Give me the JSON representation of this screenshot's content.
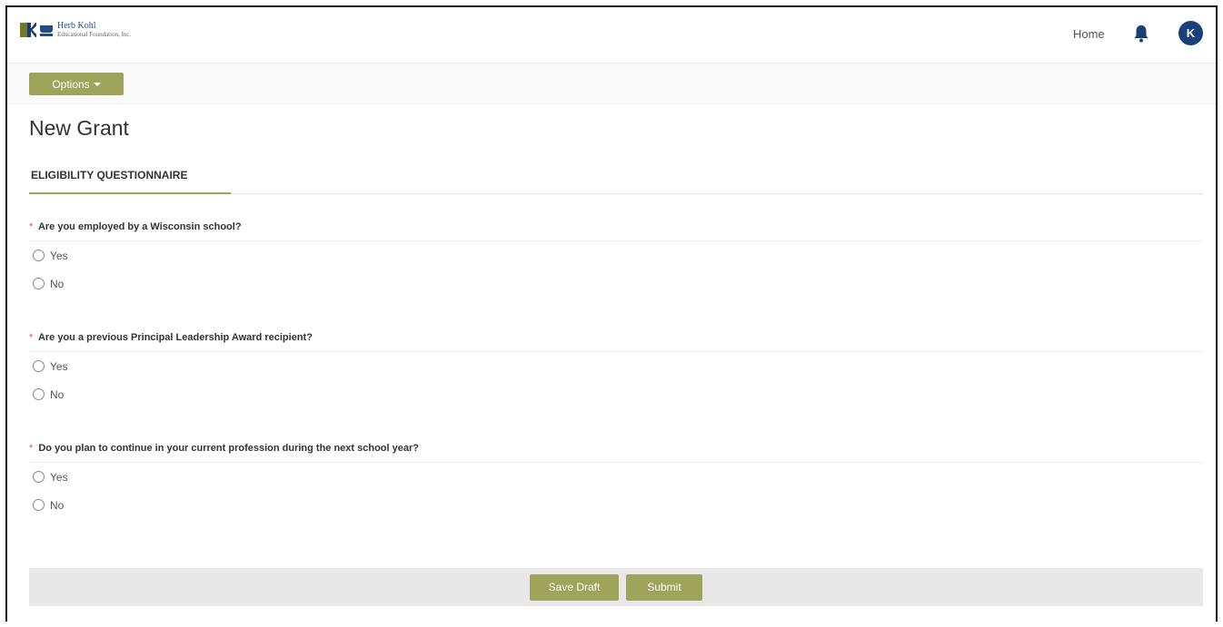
{
  "header": {
    "logo_line1": "Herb Kohl",
    "logo_line2": "Educational Foundation, Inc.",
    "home_label": "Home",
    "avatar_initial": "K",
    "brand_color": "#1a3f7a"
  },
  "options_bar": {
    "options_label": "Options",
    "accent_color": "#9ea459"
  },
  "page": {
    "title": "New Grant",
    "tab_label": "ELIGIBILITY QUESTIONNAIRE"
  },
  "questions": [
    {
      "required_marker": "*",
      "label": "Are you employed by a Wisconsin school?",
      "options": [
        "Yes",
        "No"
      ]
    },
    {
      "required_marker": "*",
      "label": "Are you a previous Principal Leadership Award recipient?",
      "options": [
        "Yes",
        "No"
      ]
    },
    {
      "required_marker": "*",
      "label": "Do you plan to continue in your current profession during the next school year?",
      "options": [
        "Yes",
        "No"
      ]
    }
  ],
  "footer": {
    "save_draft_label": "Save Draft",
    "submit_label": "Submit"
  }
}
